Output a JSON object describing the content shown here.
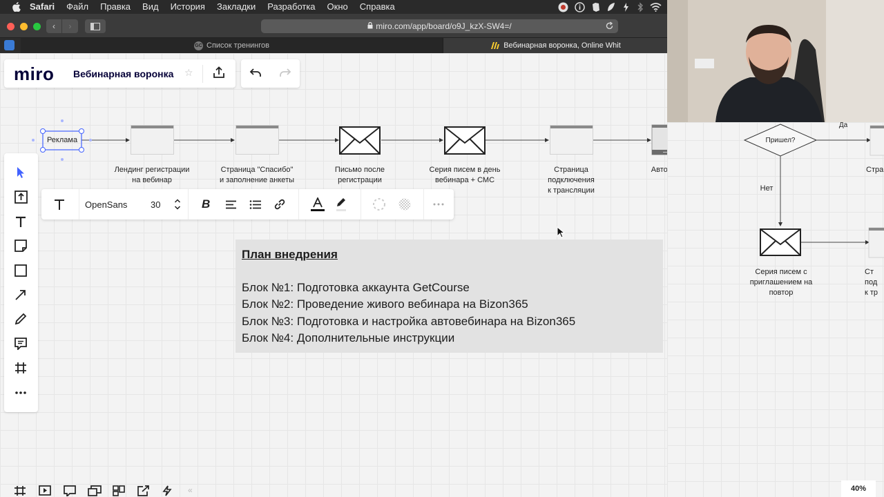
{
  "menubar": {
    "items": [
      "Safari",
      "Файл",
      "Правка",
      "Вид",
      "История",
      "Закладки",
      "Разработка",
      "Окно",
      "Справка"
    ]
  },
  "browser": {
    "url": "miro.com/app/board/o9J_kzX-SW4=/",
    "tabs": [
      {
        "label": "Список тренингов",
        "icon_text": "GC"
      },
      {
        "label": "Вебинарная воронка, Online Whit"
      }
    ]
  },
  "miro": {
    "logo": "miro",
    "board_name": "Вебинарная воронка",
    "text_toolbar": {
      "font": "OpenSans",
      "size": "30"
    },
    "zoom": "40%"
  },
  "flow": {
    "ad": "Реклама",
    "landing": "Лендинг регистрации\nна вебинар",
    "thanks": "Страница \"Спасибо\"\nи заполнение анкеты",
    "email_after": "Письмо после\nрегистрации",
    "email_series": "Серия писем в день\nвебинара + СМС",
    "connect_page": "Страница\nподключения\nк трансляции",
    "autowebinar": "Автовебинар",
    "decision": "Пришел?",
    "yes": "Да",
    "no": "Нет",
    "cut_page_top": "Страни",
    "replay_series": "Серия писем с\nприглашением на\nповтор",
    "cut_page_bottom": "Ст\nпод\nк тр"
  },
  "plan": {
    "title": "План внедрения",
    "lines": [
      "Блок №1: Подготовка аккаунта GetCourse",
      "Блок №2: Проведение живого вебинара на Bizon365",
      "Блок №3: Подготовка и настройка автовебинара на Bizon365",
      "Блок №4: Дополнительные инструкции"
    ]
  },
  "colors": {
    "miro_navy": "#050038",
    "selection_blue": "#4262ff",
    "tool_blue": "#4262ff"
  }
}
